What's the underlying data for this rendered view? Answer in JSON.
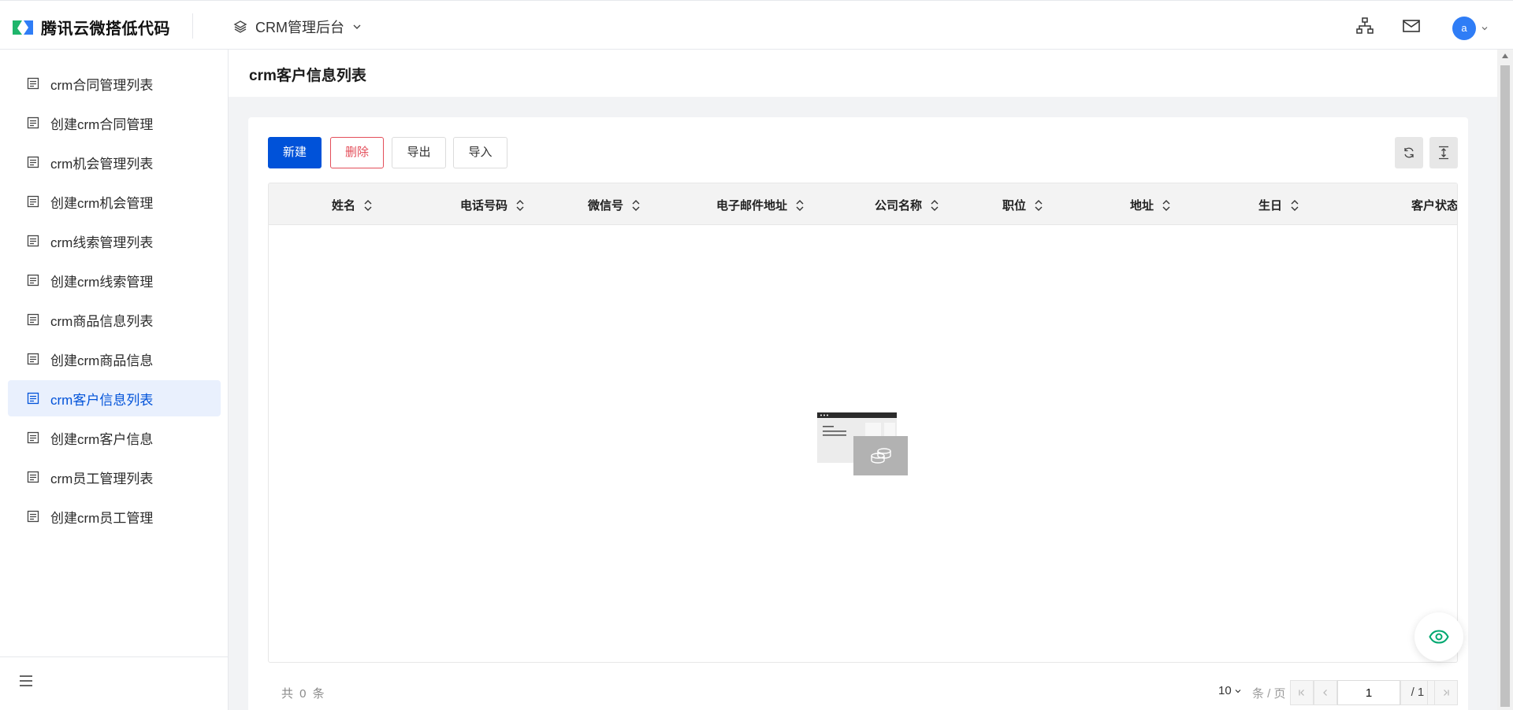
{
  "header": {
    "brand": "腾讯云微搭低代码",
    "app_name": "CRM管理后台",
    "avatar_letter": "a"
  },
  "sidebar": {
    "items": [
      {
        "label": "crm合同管理列表",
        "active": false
      },
      {
        "label": "创建crm合同管理",
        "active": false
      },
      {
        "label": "crm机会管理列表",
        "active": false
      },
      {
        "label": "创建crm机会管理",
        "active": false
      },
      {
        "label": "crm线索管理列表",
        "active": false
      },
      {
        "label": "创建crm线索管理",
        "active": false
      },
      {
        "label": "crm商品信息列表",
        "active": false
      },
      {
        "label": "创建crm商品信息",
        "active": false
      },
      {
        "label": "crm客户信息列表",
        "active": true
      },
      {
        "label": "创建crm客户信息",
        "active": false
      },
      {
        "label": "crm员工管理列表",
        "active": false
      },
      {
        "label": "创建crm员工管理",
        "active": false
      }
    ]
  },
  "page": {
    "title": "crm客户信息列表"
  },
  "toolbar": {
    "new_label": "新建",
    "delete_label": "删除",
    "export_label": "导出",
    "import_label": "导入"
  },
  "table": {
    "columns": [
      "姓名",
      "电话号码",
      "微信号",
      "电子邮件地址",
      "公司名称",
      "职位",
      "地址",
      "生日",
      "客户状态"
    ],
    "rows": []
  },
  "pagination": {
    "total_text": "共 0 条",
    "page_size": "10",
    "page_size_unit": "条 / 页",
    "current_page": "1",
    "total_pages_text": "/ 1 页"
  },
  "colors": {
    "primary": "#0052d9",
    "danger": "#e34d59",
    "active_bg": "#e9f0fd",
    "eye_icon": "#00a870"
  }
}
